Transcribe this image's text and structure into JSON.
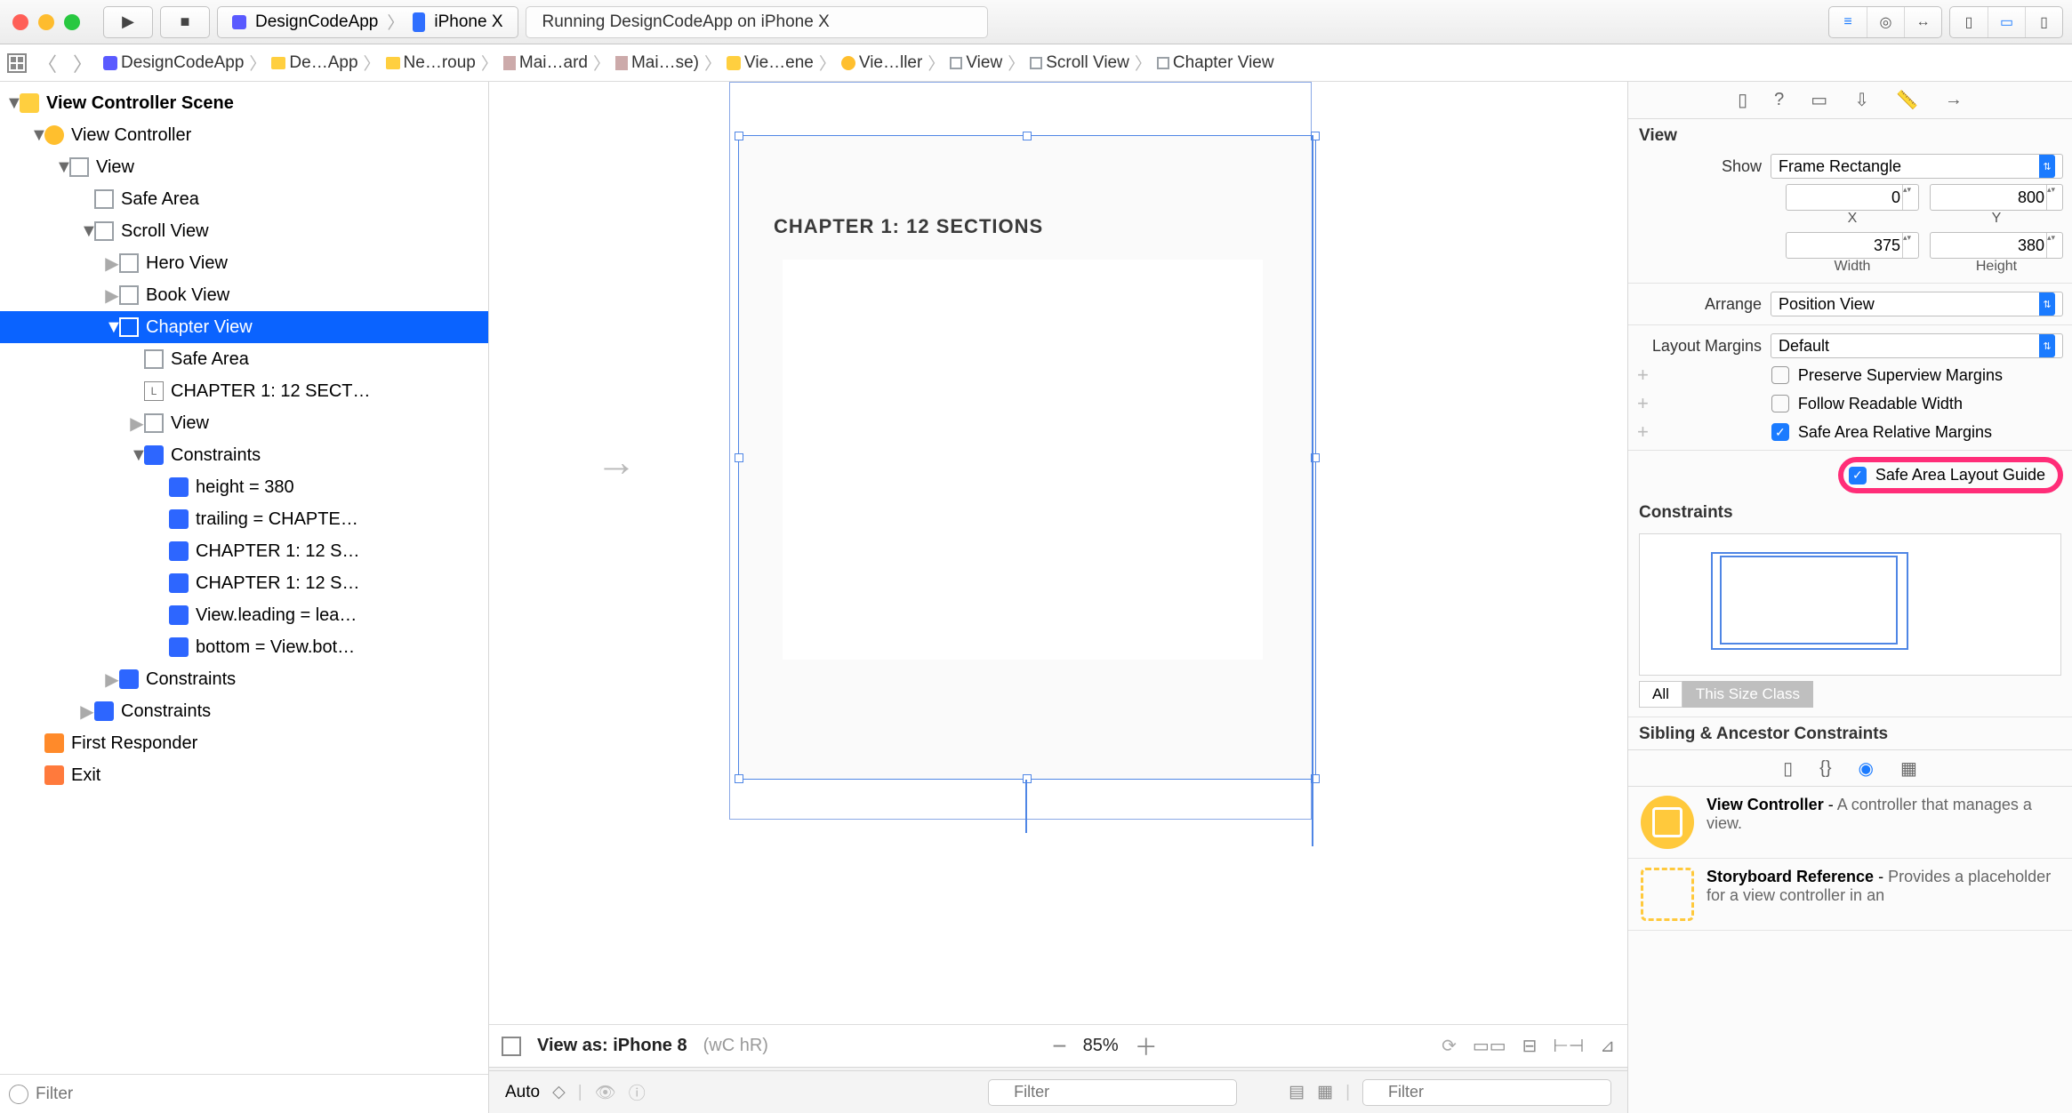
{
  "toolbar": {
    "scheme_app": "DesignCodeApp",
    "scheme_device": "iPhone X",
    "status": "Running DesignCodeApp on iPhone X"
  },
  "jumpbar": {
    "items": [
      "DesignCodeApp",
      "De…App",
      "Ne…roup",
      "Mai…ard",
      "Mai…se)",
      "Vie…ene",
      "Vie…ller",
      "View",
      "Scroll View",
      "Chapter View"
    ]
  },
  "tree": {
    "scene": "View Controller Scene",
    "vc": "View Controller",
    "view": "View",
    "safe_area": "Safe Area",
    "scroll_view": "Scroll View",
    "hero_view": "Hero View",
    "book_view": "Book View",
    "chapter_view": "Chapter View",
    "cv_safe_area": "Safe Area",
    "cv_label": "CHAPTER 1: 12 SECT…",
    "cv_view": "View",
    "cv_constraints": "Constraints",
    "cons": [
      "height = 380",
      "trailing = CHAPTE…",
      "CHAPTER 1: 12 S…",
      "CHAPTER 1: 12 S…",
      "View.leading = lea…",
      "bottom = View.bot…"
    ],
    "sv_constraints": "Constraints",
    "v_constraints": "Constraints",
    "first_responder": "First Responder",
    "exit": "Exit",
    "filter_placeholder": "Filter"
  },
  "canvas": {
    "chapter_title": "CHAPTER 1: 12 SECTIONS",
    "view_as": "View as: iPhone 8",
    "view_as_traits": "(wC hR)",
    "zoom": "85%"
  },
  "debug": {
    "project": "DesignCodeApp"
  },
  "bottom": {
    "auto": "Auto",
    "filter_placeholder": "Filter",
    "filter_placeholder2": "Filter"
  },
  "inspector": {
    "view_h": "View",
    "show_l": "Show",
    "show_v": "Frame Rectangle",
    "x": "0",
    "y": "800",
    "width": "375",
    "height": "380",
    "x_l": "X",
    "y_l": "Y",
    "w_l": "Width",
    "h_l": "Height",
    "arrange_l": "Arrange",
    "arrange_v": "Position View",
    "margins_l": "Layout Margins",
    "margins_v": "Default",
    "chk1": "Preserve Superview Margins",
    "chk2": "Follow Readable Width",
    "chk3": "Safe Area Relative Margins",
    "chk4": "Safe Area Layout Guide",
    "constraints_h": "Constraints",
    "all": "All",
    "this_size": "This Size Class",
    "sibling_h": "Sibling & Ancestor Constraints",
    "lib1_t": "View Controller",
    "lib1_d": "A controller that manages a view.",
    "lib2_t": "Storyboard Reference",
    "lib2_d": "Provides a placeholder for a view controller in an"
  }
}
